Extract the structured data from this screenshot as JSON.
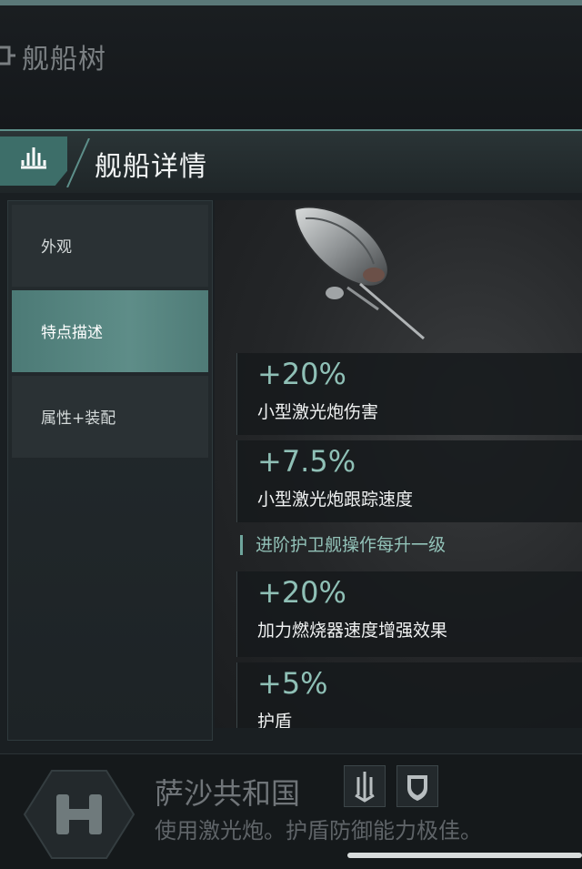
{
  "top": {
    "title": "舰船树"
  },
  "header": {
    "title": "舰船详情"
  },
  "tabs": [
    {
      "label": "外观"
    },
    {
      "label": "特点描述"
    },
    {
      "label": "属性+装配"
    }
  ],
  "stats": [
    {
      "value": "+20%",
      "label": "小型激光炮伤害"
    },
    {
      "value": "+7.5%",
      "label": "小型激光炮跟踪速度"
    }
  ],
  "section": {
    "title": "进阶护卫舰操作每升一级"
  },
  "stats2": [
    {
      "value": "+20%",
      "label": "加力燃烧器速度增强效果"
    },
    {
      "value": "+5%",
      "label": "护盾"
    }
  ],
  "faction": {
    "name": "萨沙共和国",
    "description": "使用激光炮。护盾防御能力极佳。"
  },
  "icons": [
    "tree-icon",
    "ship-icon",
    "faction-emblem-icon",
    "laser-weapon-icon",
    "shield-icon"
  ],
  "colors": {
    "accent": "#5e8d88",
    "value_text": "#8fc0b6",
    "background": "#121518"
  }
}
